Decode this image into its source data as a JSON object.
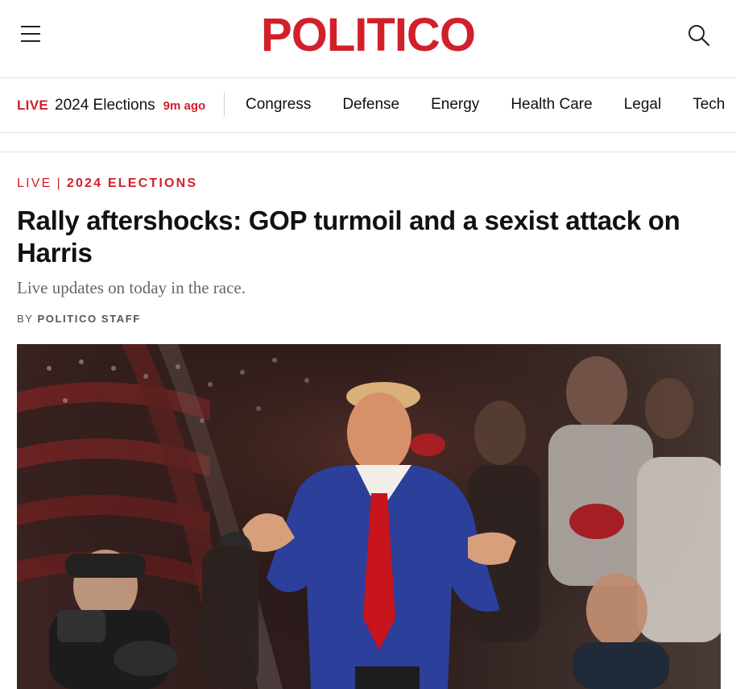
{
  "brand": {
    "logo_text": "POLITICO",
    "accent": "#d21f2a"
  },
  "header": {
    "menu_icon": "hamburger-menu-icon",
    "search_icon": "search-icon"
  },
  "nav": {
    "live_label": "LIVE",
    "live_title": "2024 Elections",
    "live_time": "9m ago",
    "items": [
      "Congress",
      "Defense",
      "Energy",
      "Health Care",
      "Legal",
      "Tech"
    ]
  },
  "article": {
    "kicker_live": "LIVE",
    "kicker_sep": "|",
    "kicker_section": "2024 ELECTIONS",
    "headline": "Rally aftershocks: GOP turmoil and a sexist attack on Harris",
    "dek": "Live updates on today in the race.",
    "byline_prefix": "BY",
    "byline_author": "POLITICO STAFF"
  }
}
